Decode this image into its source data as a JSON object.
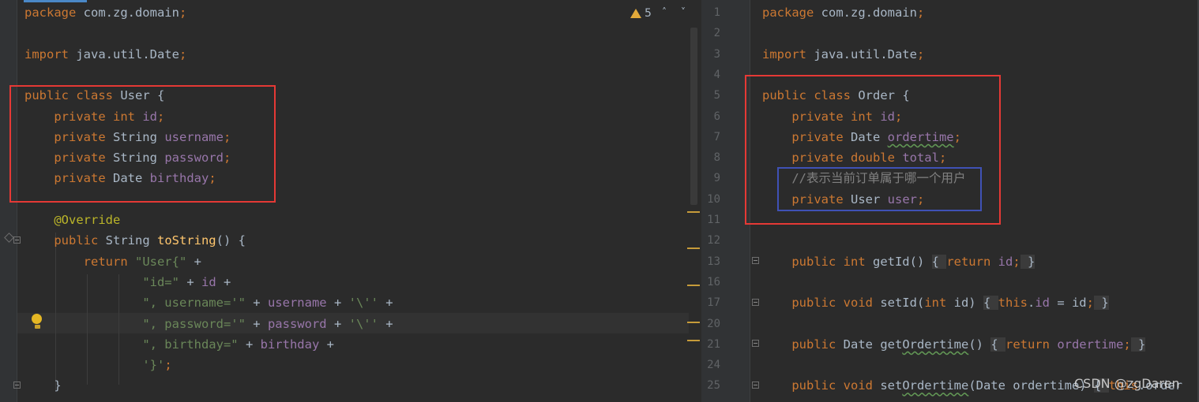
{
  "editor_left": {
    "warning_count": "5",
    "lines": [
      [
        [
          "kw",
          "package "
        ],
        [
          "",
          "com.zg.domain"
        ],
        [
          "kw",
          ";"
        ]
      ],
      [],
      [
        [
          "kw",
          "import "
        ],
        [
          "",
          "java.util.Date"
        ],
        [
          "kw",
          ";"
        ]
      ],
      [],
      [
        [
          "kw",
          "public class "
        ],
        [
          "",
          "User {"
        ]
      ],
      [
        [
          "",
          "    "
        ],
        [
          "kw",
          "private int "
        ],
        [
          "fld",
          "id"
        ],
        [
          "kw",
          ";"
        ]
      ],
      [
        [
          "",
          "    "
        ],
        [
          "kw",
          "private "
        ],
        [
          "",
          "String "
        ],
        [
          "fld",
          "username"
        ],
        [
          "kw",
          ";"
        ]
      ],
      [
        [
          "",
          "    "
        ],
        [
          "kw",
          "private "
        ],
        [
          "",
          "String "
        ],
        [
          "fld",
          "password"
        ],
        [
          "kw",
          ";"
        ]
      ],
      [
        [
          "",
          "    "
        ],
        [
          "kw",
          "private "
        ],
        [
          "",
          "Date "
        ],
        [
          "fld",
          "birthday"
        ],
        [
          "kw",
          ";"
        ]
      ],
      [],
      [
        [
          "",
          "    "
        ],
        [
          "ann",
          "@Override"
        ]
      ],
      [
        [
          "",
          "    "
        ],
        [
          "kw",
          "public "
        ],
        [
          "",
          "String "
        ],
        [
          "fn",
          "toString"
        ],
        [
          "",
          "() {"
        ]
      ],
      [
        [
          "",
          "        "
        ],
        [
          "kw",
          "return "
        ],
        [
          "str",
          "\"User{\""
        ],
        [
          "",
          " +"
        ]
      ],
      [
        [
          "",
          "                "
        ],
        [
          "str",
          "\"id=\""
        ],
        [
          "",
          " + "
        ],
        [
          "fld",
          "id"
        ],
        [
          "",
          " +"
        ]
      ],
      [
        [
          "",
          "                "
        ],
        [
          "str",
          "\", username='\""
        ],
        [
          "",
          " + "
        ],
        [
          "fld",
          "username"
        ],
        [
          "",
          " + "
        ],
        [
          "str",
          "'\\''"
        ],
        [
          "",
          " +"
        ]
      ],
      [
        [
          "",
          "                "
        ],
        [
          "str",
          "\", password='\""
        ],
        [
          "",
          " + "
        ],
        [
          "fld",
          "password"
        ],
        [
          "",
          " + "
        ],
        [
          "str",
          "'\\''"
        ],
        [
          "",
          " +"
        ]
      ],
      [
        [
          "",
          "                "
        ],
        [
          "str",
          "\", birthday=\""
        ],
        [
          "",
          " + "
        ],
        [
          "fld",
          "birthday"
        ],
        [
          "",
          " +"
        ]
      ],
      [
        [
          "",
          "                "
        ],
        [
          "str",
          "'}'"
        ],
        [
          "kw",
          ";"
        ]
      ],
      [
        [
          "",
          "    }"
        ]
      ]
    ]
  },
  "editor_right": {
    "line_numbers": [
      "1",
      "2",
      "3",
      "4",
      "5",
      "6",
      "7",
      "8",
      "9",
      "10",
      "11",
      "12",
      "13",
      "16",
      "17",
      "20",
      "21",
      "24",
      "25"
    ],
    "lines": [
      [
        [
          "kw",
          "package "
        ],
        [
          "",
          "com.zg.domain"
        ],
        [
          "kw",
          ";"
        ]
      ],
      [],
      [
        [
          "kw",
          "import "
        ],
        [
          "",
          "java.util.Date"
        ],
        [
          "kw",
          ";"
        ]
      ],
      [],
      [
        [
          "kw",
          "public class "
        ],
        [
          "",
          "Order {"
        ]
      ],
      [
        [
          "",
          "    "
        ],
        [
          "kw",
          "private int "
        ],
        [
          "fld",
          "id"
        ],
        [
          "kw",
          ";"
        ]
      ],
      [
        [
          "",
          "    "
        ],
        [
          "kw",
          "private "
        ],
        [
          "",
          "Date "
        ],
        [
          "fldsq",
          "ordertime"
        ],
        [
          "kw",
          ";"
        ]
      ],
      [
        [
          "",
          "    "
        ],
        [
          "kw",
          "private double "
        ],
        [
          "fld",
          "total"
        ],
        [
          "kw",
          ";"
        ]
      ],
      [
        [
          "",
          "    "
        ],
        [
          "cm",
          "//表示当前订单属于哪一个用户"
        ]
      ],
      [
        [
          "",
          "    "
        ],
        [
          "kw",
          "private "
        ],
        [
          "",
          "User "
        ],
        [
          "fld",
          "user"
        ],
        [
          "kw",
          ";"
        ]
      ],
      [],
      [],
      [
        [
          "",
          "    "
        ],
        [
          "kw",
          "public int "
        ],
        [
          "",
          "getId() "
        ],
        [
          "fb",
          "{ "
        ],
        [
          "kw",
          "return "
        ],
        [
          "fld",
          "id"
        ],
        [
          "kw",
          ";"
        ],
        [
          "fb",
          " }"
        ]
      ],
      [],
      [
        [
          "",
          "    "
        ],
        [
          "kw",
          "public void "
        ],
        [
          "",
          "setId("
        ],
        [
          "kw",
          "int "
        ],
        [
          "",
          "id) "
        ],
        [
          "fb",
          "{ "
        ],
        [
          "kw",
          "this"
        ],
        [
          "",
          ".",
          ""
        ],
        [
          "fld",
          "id"
        ],
        [
          "",
          " = id"
        ],
        [
          "kw",
          ";"
        ],
        [
          "fb",
          " }"
        ]
      ],
      [],
      [
        [
          "",
          "    "
        ],
        [
          "kw",
          "public "
        ],
        [
          "",
          "Date get"
        ],
        [
          "sq",
          "Ordertime"
        ],
        [
          "",
          "() "
        ],
        [
          "fb",
          "{ "
        ],
        [
          "kw",
          "return "
        ],
        [
          "fld",
          "ordertime"
        ],
        [
          "kw",
          ";"
        ],
        [
          "fb",
          " }"
        ]
      ],
      [],
      [
        [
          "",
          "    "
        ],
        [
          "kw",
          "public void "
        ],
        [
          "",
          "set"
        ],
        [
          "sq",
          "Ordertime"
        ],
        [
          "",
          "(Date order"
        ],
        [
          "",
          "time) "
        ],
        [
          "fb",
          "{ "
        ],
        [
          "kw",
          "this"
        ],
        [
          "",
          ".order"
        ]
      ]
    ]
  },
  "watermark": "CSDN @zgDaren"
}
